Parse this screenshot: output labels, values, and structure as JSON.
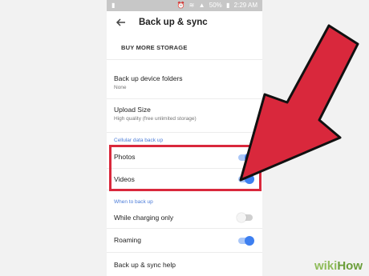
{
  "status_bar": {
    "battery": "50%",
    "time": "2:29 AM"
  },
  "app_bar": {
    "title": "Back up & sync",
    "back_icon": "arrow-back-icon"
  },
  "buy_storage": "BUY MORE STORAGE",
  "settings": {
    "backup_folders": {
      "title": "Back up device folders",
      "subtitle": "None"
    },
    "upload_size": {
      "title": "Upload Size",
      "subtitle": "High quality (free unlimited storage)"
    },
    "cellular_header": "Cellular data back up",
    "photos": {
      "title": "Photos",
      "enabled": true
    },
    "videos": {
      "title": "Videos",
      "enabled": true
    },
    "when_header": "When to back up",
    "charging_only": {
      "title": "While charging only",
      "enabled": false
    },
    "roaming": {
      "title": "Roaming",
      "enabled": true
    },
    "help": {
      "title": "Back up & sync help"
    }
  },
  "colors": {
    "accent": "#3d7ff0",
    "highlight": "#d9283c",
    "arrow": "#d9283c"
  },
  "watermark": {
    "prefix": "wiki",
    "suffix": "How"
  }
}
